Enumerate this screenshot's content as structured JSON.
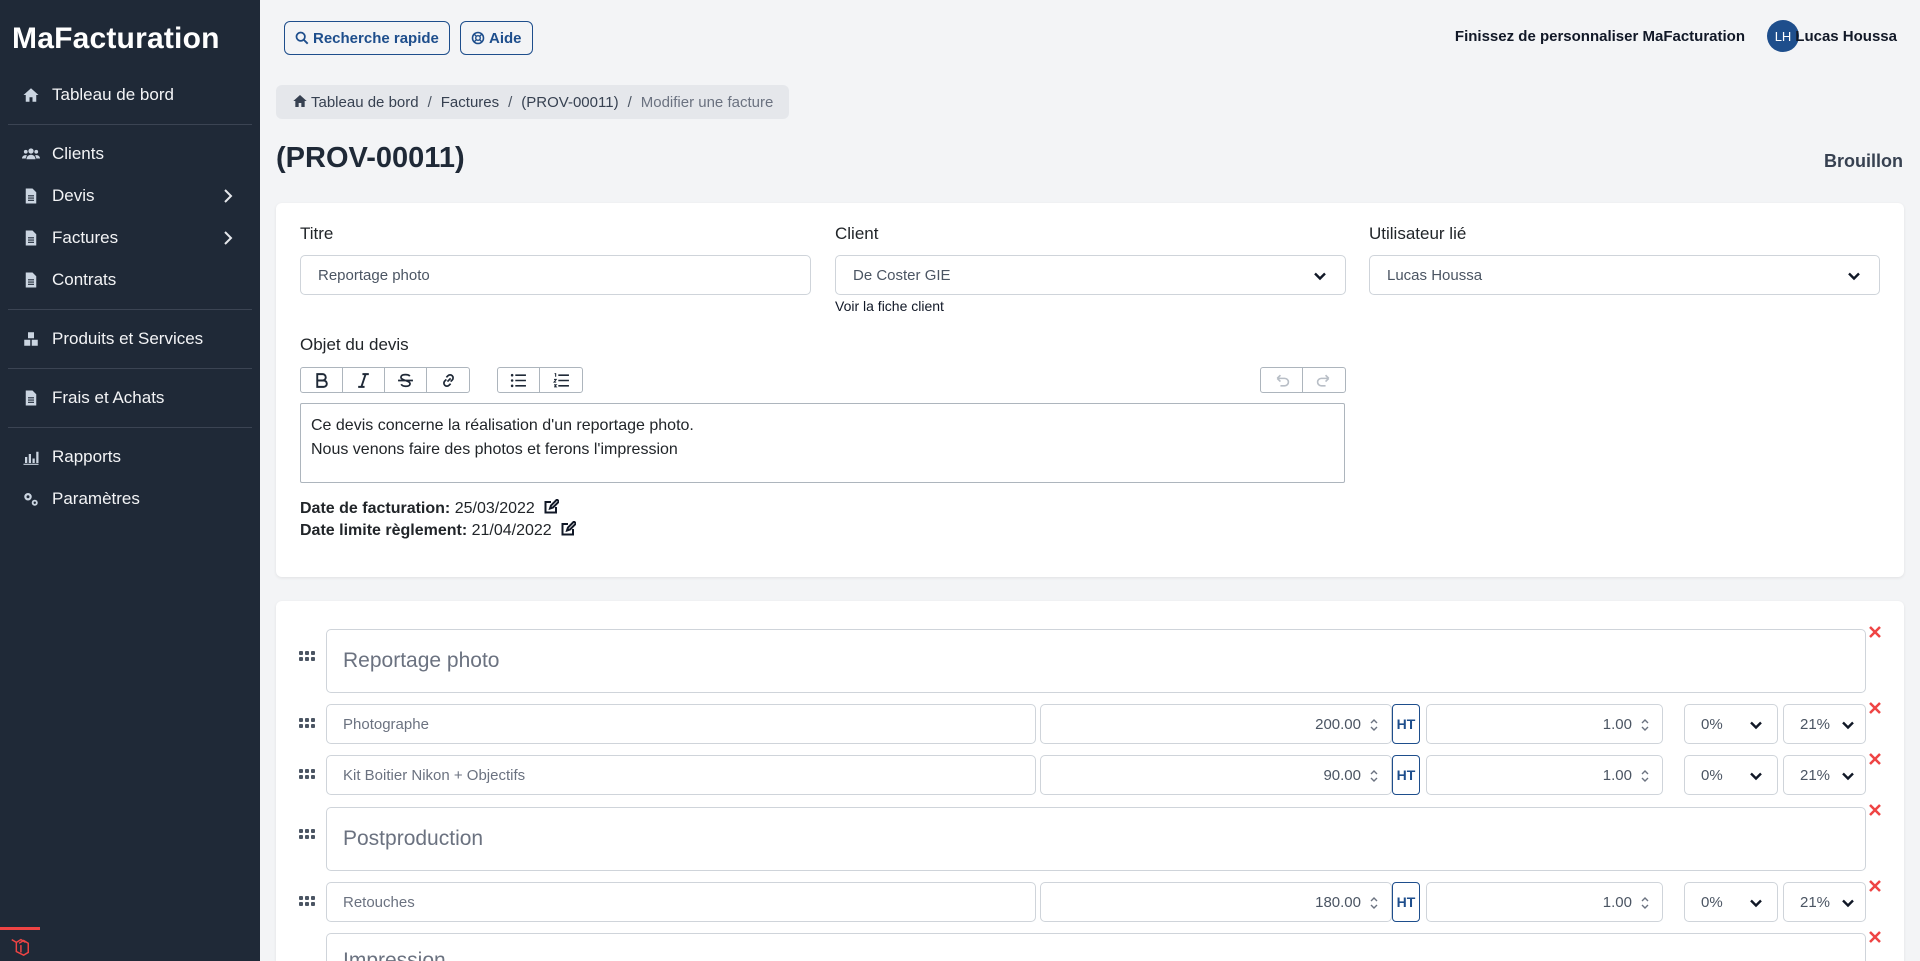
{
  "app": {
    "brand": "MaFacturation"
  },
  "sidebar": {
    "items": [
      {
        "label": "Tableau de bord",
        "icon": "home-icon"
      },
      {
        "label": "Clients",
        "icon": "users-icon"
      },
      {
        "label": "Devis",
        "icon": "document-icon",
        "has_children": true
      },
      {
        "label": "Factures",
        "icon": "document-icon",
        "has_children": true
      },
      {
        "label": "Contrats",
        "icon": "document-icon"
      },
      {
        "label": "Produits et Services",
        "icon": "boxes-icon"
      },
      {
        "label": "Frais et Achats",
        "icon": "document-icon"
      },
      {
        "label": "Rapports",
        "icon": "chart-icon"
      },
      {
        "label": "Paramètres",
        "icon": "gears-icon"
      }
    ]
  },
  "topbar": {
    "quick_search_label": "Recherche rapide",
    "help_label": "Aide",
    "customize_text": "Finissez de personnaliser MaFacturation",
    "user_initials": "LH",
    "user_name": "Lucas Houssa"
  },
  "breadcrumb": {
    "items": [
      "Tableau de bord",
      "Factures",
      "(PROV-00011)",
      "Modifier une facture"
    ]
  },
  "page": {
    "title": "(PROV-00011)",
    "status": "Brouillon"
  },
  "form": {
    "title_label": "Titre",
    "title_value": "Reportage photo",
    "client_label": "Client",
    "client_value": "De Coster GIE",
    "client_link": "Voir la fiche client",
    "user_label": "Utilisateur lié",
    "user_value": "Lucas Houssa",
    "object_label": "Objet du devis",
    "object_lines": [
      "Ce devis concerne la réalisation d'un reportage photo.",
      "Nous venons faire des photos et ferons l'impression"
    ],
    "invoice_date_label": "Date de facturation:",
    "invoice_date_value": "25/03/2022",
    "due_date_label": "Date limite règlement:",
    "due_date_value": "21/04/2022"
  },
  "lines": {
    "sections": [
      "Reportage photo",
      "Postproduction",
      "Impression"
    ],
    "items": [
      {
        "description": "Photographe",
        "price": "200.00",
        "price_mode": "HT",
        "quantity": "1.00",
        "discount": "0%",
        "vat": "21%"
      },
      {
        "description": "Kit Boitier Nikon + Objectifs",
        "price": "90.00",
        "price_mode": "HT",
        "quantity": "1.00",
        "discount": "0%",
        "vat": "21%"
      },
      {
        "description": "Retouches",
        "price": "180.00",
        "price_mode": "HT",
        "quantity": "1.00",
        "discount": "0%",
        "vat": "21%"
      }
    ]
  },
  "colors": {
    "sidebar_bg": "#1f2937",
    "accent": "#1e4e8c",
    "danger": "#ef4444",
    "page_bg": "#f3f4f6"
  }
}
